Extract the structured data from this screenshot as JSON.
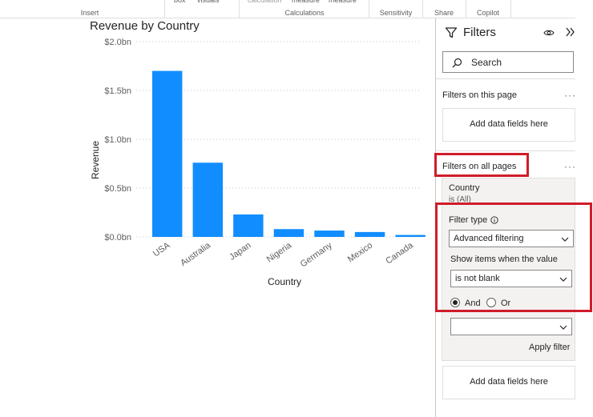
{
  "ribbon": {
    "fragments": [
      "box",
      "visuals",
      "calculation",
      "measure",
      "measure"
    ],
    "groups": [
      "Insert",
      "Calculations",
      "Sensitivity",
      "Share",
      "Copilot"
    ]
  },
  "chart_data": {
    "type": "bar",
    "title": "Revenue by Country",
    "xlabel": "Country",
    "ylabel": "Revenue",
    "categories": [
      "USA",
      "Australia",
      "Japan",
      "Nigeria",
      "Germany",
      "Mexico",
      "Canada"
    ],
    "values": [
      1.7,
      0.76,
      0.23,
      0.08,
      0.065,
      0.05,
      0.02
    ],
    "unit": "bn",
    "ylim": [
      0,
      2.0
    ],
    "y_ticks": [
      "$0.0bn",
      "$0.5bn",
      "$1.0bn",
      "$1.5bn",
      "$2.0bn"
    ],
    "grid": true,
    "bar_color": "#118dff"
  },
  "filters": {
    "title": "Filters",
    "search_label": "Search",
    "on_this_page_label": "Filters on this page",
    "on_this_page_dropzone": "Add data fields here",
    "on_all_pages_label": "Filters on all pages",
    "card": {
      "field": "Country",
      "summary": "is (All)",
      "filter_type_label": "Filter type",
      "filter_type_value": "Advanced filtering",
      "show_items_label": "Show items when the value",
      "condition_value": "is not blank",
      "and_label": "And",
      "or_label": "Or",
      "and_selected": true,
      "second_condition_value": "",
      "apply_label": "Apply filter"
    },
    "bottom_dropzone": "Add data fields here"
  },
  "colors": {
    "highlight": "#d01c29",
    "bar": "#118dff"
  }
}
